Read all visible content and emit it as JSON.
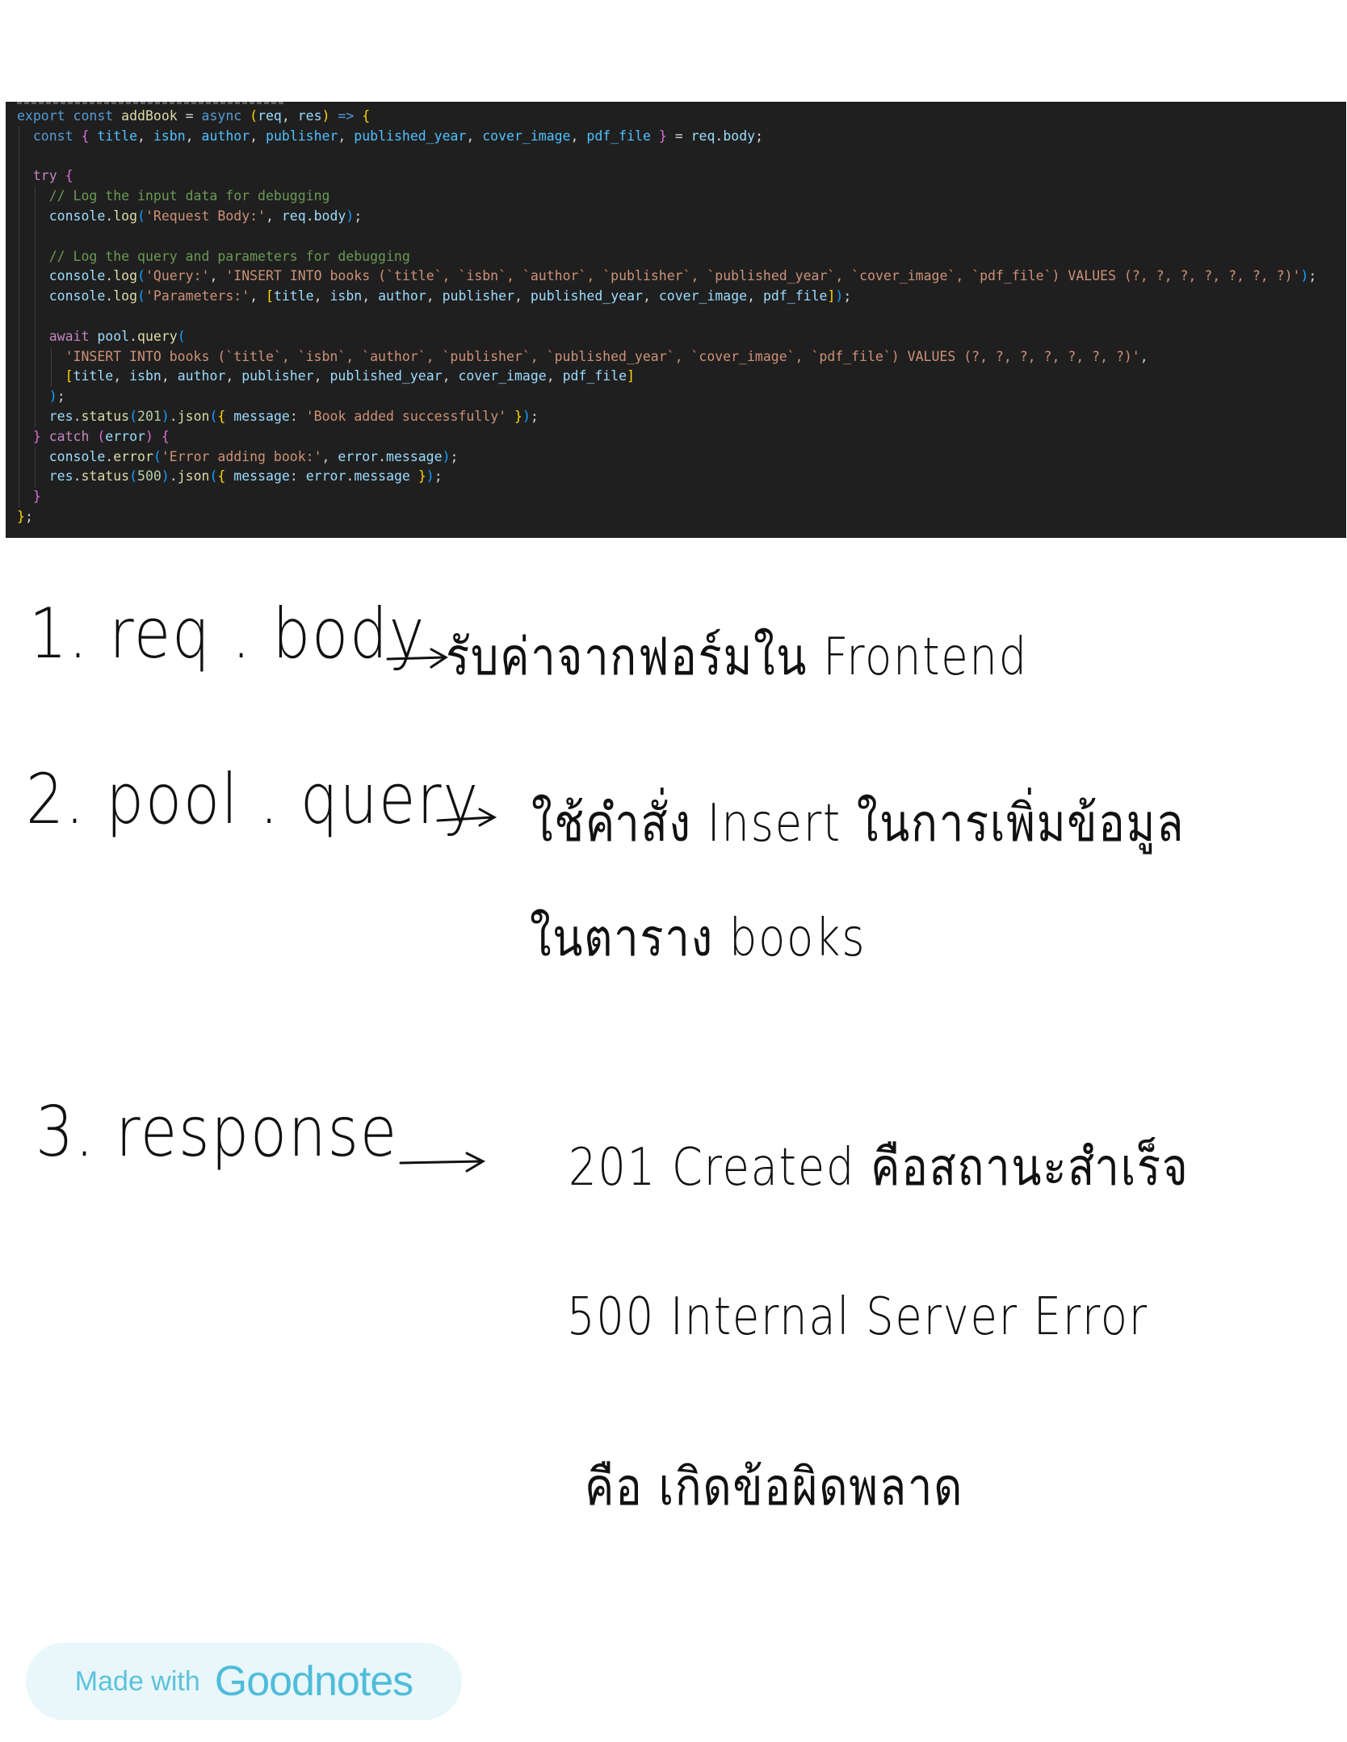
{
  "code": {
    "lines": [
      {
        "indent": 0,
        "tokens": [
          [
            "kw",
            "export"
          ],
          [
            "pun",
            " "
          ],
          [
            "kw",
            "const"
          ],
          [
            "pun",
            " "
          ],
          [
            "fn",
            "addBook"
          ],
          [
            "pun",
            " = "
          ],
          [
            "kw",
            "async"
          ],
          [
            "pun",
            " "
          ],
          [
            "b1",
            "("
          ],
          [
            "var",
            "req"
          ],
          [
            "pun",
            ", "
          ],
          [
            "var",
            "res"
          ],
          [
            "b1",
            ")"
          ],
          [
            "pun",
            " "
          ],
          [
            "kw",
            "=>"
          ],
          [
            "pun",
            " "
          ],
          [
            "b1",
            "{"
          ]
        ]
      },
      {
        "indent": 1,
        "tokens": [
          [
            "kw",
            "const"
          ],
          [
            "pun",
            " "
          ],
          [
            "b2",
            "{"
          ],
          [
            "pun",
            " "
          ],
          [
            "cst",
            "title"
          ],
          [
            "pun",
            ", "
          ],
          [
            "cst",
            "isbn"
          ],
          [
            "pun",
            ", "
          ],
          [
            "cst",
            "author"
          ],
          [
            "pun",
            ", "
          ],
          [
            "cst",
            "publisher"
          ],
          [
            "pun",
            ", "
          ],
          [
            "cst",
            "published_year"
          ],
          [
            "pun",
            ", "
          ],
          [
            "cst",
            "cover_image"
          ],
          [
            "pun",
            ", "
          ],
          [
            "cst",
            "pdf_file"
          ],
          [
            "pun",
            " "
          ],
          [
            "b2",
            "}"
          ],
          [
            "pun",
            " = "
          ],
          [
            "var",
            "req"
          ],
          [
            "pun",
            "."
          ],
          [
            "var",
            "body"
          ],
          [
            "pun",
            ";"
          ]
        ]
      },
      {
        "indent": 1,
        "tokens": []
      },
      {
        "indent": 1,
        "tokens": [
          [
            "ctl",
            "try"
          ],
          [
            "pun",
            " "
          ],
          [
            "b2",
            "{"
          ]
        ]
      },
      {
        "indent": 2,
        "tokens": [
          [
            "com",
            "// Log the input data for debugging"
          ]
        ]
      },
      {
        "indent": 2,
        "tokens": [
          [
            "var",
            "console"
          ],
          [
            "pun",
            "."
          ],
          [
            "fn",
            "log"
          ],
          [
            "b3",
            "("
          ],
          [
            "str",
            "'Request Body:'"
          ],
          [
            "pun",
            ", "
          ],
          [
            "var",
            "req"
          ],
          [
            "pun",
            "."
          ],
          [
            "var",
            "body"
          ],
          [
            "b3",
            ")"
          ],
          [
            "pun",
            ";"
          ]
        ]
      },
      {
        "indent": 2,
        "tokens": []
      },
      {
        "indent": 2,
        "tokens": [
          [
            "com",
            "// Log the query and parameters for debugging"
          ]
        ]
      },
      {
        "indent": 2,
        "tokens": [
          [
            "var",
            "console"
          ],
          [
            "pun",
            "."
          ],
          [
            "fn",
            "log"
          ],
          [
            "b3",
            "("
          ],
          [
            "str",
            "'Query:'"
          ],
          [
            "pun",
            ", "
          ],
          [
            "str",
            "'INSERT INTO books (`title`, `isbn`, `author`, `publisher`, `published_year`, `cover_image`, `pdf_file`) VALUES (?, ?, ?, ?, ?, ?, ?)'"
          ],
          [
            "b3",
            ")"
          ],
          [
            "pun",
            ";"
          ]
        ]
      },
      {
        "indent": 2,
        "tokens": [
          [
            "var",
            "console"
          ],
          [
            "pun",
            "."
          ],
          [
            "fn",
            "log"
          ],
          [
            "b3",
            "("
          ],
          [
            "str",
            "'Parameters:'"
          ],
          [
            "pun",
            ", "
          ],
          [
            "b1",
            "["
          ],
          [
            "var",
            "title"
          ],
          [
            "pun",
            ", "
          ],
          [
            "var",
            "isbn"
          ],
          [
            "pun",
            ", "
          ],
          [
            "var",
            "author"
          ],
          [
            "pun",
            ", "
          ],
          [
            "var",
            "publisher"
          ],
          [
            "pun",
            ", "
          ],
          [
            "var",
            "published_year"
          ],
          [
            "pun",
            ", "
          ],
          [
            "var",
            "cover_image"
          ],
          [
            "pun",
            ", "
          ],
          [
            "var",
            "pdf_file"
          ],
          [
            "b1",
            "]"
          ],
          [
            "b3",
            ")"
          ],
          [
            "pun",
            ";"
          ]
        ]
      },
      {
        "indent": 2,
        "tokens": []
      },
      {
        "indent": 2,
        "tokens": [
          [
            "ctl",
            "await"
          ],
          [
            "pun",
            " "
          ],
          [
            "var",
            "pool"
          ],
          [
            "pun",
            "."
          ],
          [
            "fn",
            "query"
          ],
          [
            "b3",
            "("
          ]
        ]
      },
      {
        "indent": 3,
        "tokens": [
          [
            "str",
            "'INSERT INTO books (`title`, `isbn`, `author`, `publisher`, `published_year`, `cover_image`, `pdf_file`) VALUES (?, ?, ?, ?, ?, ?, ?)'"
          ],
          [
            "pun",
            ","
          ]
        ]
      },
      {
        "indent": 3,
        "tokens": [
          [
            "b1",
            "["
          ],
          [
            "var",
            "title"
          ],
          [
            "pun",
            ", "
          ],
          [
            "var",
            "isbn"
          ],
          [
            "pun",
            ", "
          ],
          [
            "var",
            "author"
          ],
          [
            "pun",
            ", "
          ],
          [
            "var",
            "publisher"
          ],
          [
            "pun",
            ", "
          ],
          [
            "var",
            "published_year"
          ],
          [
            "pun",
            ", "
          ],
          [
            "var",
            "cover_image"
          ],
          [
            "pun",
            ", "
          ],
          [
            "var",
            "pdf_file"
          ],
          [
            "b1",
            "]"
          ]
        ]
      },
      {
        "indent": 2,
        "tokens": [
          [
            "b3",
            ")"
          ],
          [
            "pun",
            ";"
          ]
        ]
      },
      {
        "indent": 2,
        "tokens": [
          [
            "var",
            "res"
          ],
          [
            "pun",
            "."
          ],
          [
            "fn",
            "status"
          ],
          [
            "b3",
            "("
          ],
          [
            "num",
            "201"
          ],
          [
            "b3",
            ")"
          ],
          [
            "pun",
            "."
          ],
          [
            "fn",
            "json"
          ],
          [
            "b3",
            "("
          ],
          [
            "b1",
            "{"
          ],
          [
            "pun",
            " "
          ],
          [
            "var",
            "message"
          ],
          [
            "pun",
            ": "
          ],
          [
            "str",
            "'Book added successfully'"
          ],
          [
            "pun",
            " "
          ],
          [
            "b1",
            "}"
          ],
          [
            "b3",
            ")"
          ],
          [
            "pun",
            ";"
          ]
        ]
      },
      {
        "indent": 1,
        "tokens": [
          [
            "b2",
            "}"
          ],
          [
            "pun",
            " "
          ],
          [
            "ctl",
            "catch"
          ],
          [
            "pun",
            " "
          ],
          [
            "b2",
            "("
          ],
          [
            "var",
            "error"
          ],
          [
            "b2",
            ")"
          ],
          [
            "pun",
            " "
          ],
          [
            "b2",
            "{"
          ]
        ]
      },
      {
        "indent": 2,
        "tokens": [
          [
            "var",
            "console"
          ],
          [
            "pun",
            "."
          ],
          [
            "fn",
            "error"
          ],
          [
            "b3",
            "("
          ],
          [
            "str",
            "'Error adding book:'"
          ],
          [
            "pun",
            ", "
          ],
          [
            "var",
            "error"
          ],
          [
            "pun",
            "."
          ],
          [
            "var",
            "message"
          ],
          [
            "b3",
            ")"
          ],
          [
            "pun",
            ";"
          ]
        ]
      },
      {
        "indent": 2,
        "tokens": [
          [
            "var",
            "res"
          ],
          [
            "pun",
            "."
          ],
          [
            "fn",
            "status"
          ],
          [
            "b3",
            "("
          ],
          [
            "num",
            "500"
          ],
          [
            "b3",
            ")"
          ],
          [
            "pun",
            "."
          ],
          [
            "fn",
            "json"
          ],
          [
            "b3",
            "("
          ],
          [
            "b1",
            "{"
          ],
          [
            "pun",
            " "
          ],
          [
            "var",
            "message"
          ],
          [
            "pun",
            ": "
          ],
          [
            "var",
            "error"
          ],
          [
            "pun",
            "."
          ],
          [
            "var",
            "message"
          ],
          [
            "pun",
            " "
          ],
          [
            "b1",
            "}"
          ],
          [
            "b3",
            ")"
          ],
          [
            "pun",
            ";"
          ]
        ]
      },
      {
        "indent": 1,
        "tokens": [
          [
            "b2",
            "}"
          ]
        ]
      },
      {
        "indent": 0,
        "tokens": [
          [
            "b1",
            "}"
          ],
          [
            "pun",
            ";"
          ]
        ]
      }
    ]
  },
  "notes": {
    "n1_label": "1. req . body",
    "n1_text": "รับค่าจากฟอร์มใน Frontend",
    "n2_label": "2. pool . query",
    "n2_text_a": "ใช้คำสั่ง Insert ในการเพิ่มข้อมูล",
    "n2_text_b": "ในตาราง books",
    "n3_label": "3. response",
    "n3_text_a": "201 Created คือสถานะสำเร็จ",
    "n3_text_b": "500 Internal Server Error",
    "n3_text_c": "คือ เกิดข้อผิดพลาด"
  },
  "badge": {
    "made_with": "Made with",
    "brand": "Goodnotes"
  }
}
